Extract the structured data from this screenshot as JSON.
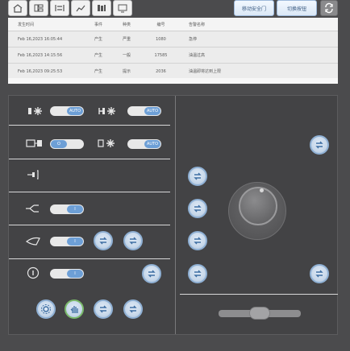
{
  "top_actions": {
    "move_safety_gate_label": "移动安全门",
    "switch_panel_label": "切换按钮"
  },
  "toolbar_icons": [
    "home-icon",
    "layout-icon",
    "rack-icon",
    "chart-icon",
    "books-icon",
    "monitor-icon"
  ],
  "alarm_table": {
    "columns": [
      "发生时间",
      "事件",
      "种类",
      "编号",
      "告警名称"
    ],
    "rows": [
      [
        "Feb 16,2023  16:05:44",
        "产生",
        "严重",
        "1080",
        "急停"
      ],
      [
        "Feb 16,2023  14:15:56",
        "产生",
        "一般",
        "17585",
        "油温过高"
      ],
      [
        "Feb 16,2023  09:25:53",
        "产生",
        "提示",
        "2036",
        "油温即将达到上限"
      ]
    ]
  },
  "controls": {
    "fan_auto_label": "AUTO",
    "heater_auto_label": "AUTO",
    "heater_auto_label_2": "AUTO",
    "pump_toggle_label": "O",
    "valve_toggle_label": "I",
    "eject_toggle_label": "I",
    "info_toggle_label": "I"
  },
  "colors": {
    "accent": "#6d9fd6",
    "panel_bg": "#434345",
    "table_bg": "#ececec",
    "success_ring": "#7ab96a"
  }
}
